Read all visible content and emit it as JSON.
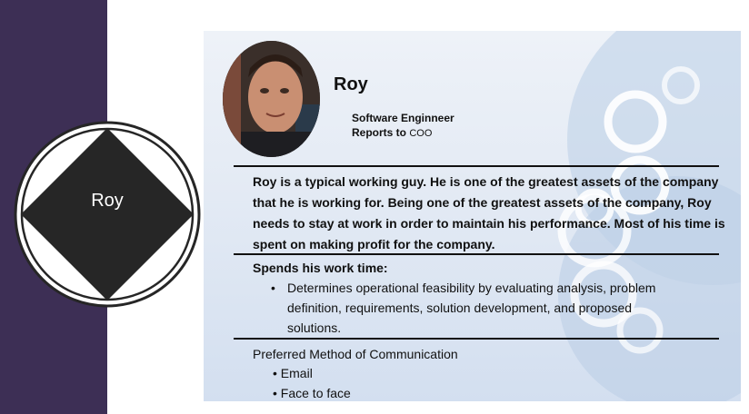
{
  "badge": {
    "label": "Roy"
  },
  "profile": {
    "name": "Roy",
    "title": "Software Enginneer",
    "reports_prefix": "Reports to",
    "reports_to": "COO"
  },
  "description": "Roy is a typical working guy. He is one of the greatest assets of the company that he is working for. Being one of the greatest assets of the company, Roy needs to stay at work in order to maintain his performance. Most of his time is spent on making profit for the company.",
  "work": {
    "heading": "Spends his work time:",
    "bullets": [
      "Determines operational feasibility by evaluating analysis, problem definition, requirements, solution development, and proposed solutions."
    ]
  },
  "communication": {
    "heading": "Preferred Method of Communication",
    "items": [
      "Email",
      "Face to face"
    ]
  },
  "colors": {
    "side_band": "#3d2f55",
    "diamond": "#262626",
    "card_light": "#eef2f8",
    "card_dark": "#d3dff0"
  }
}
